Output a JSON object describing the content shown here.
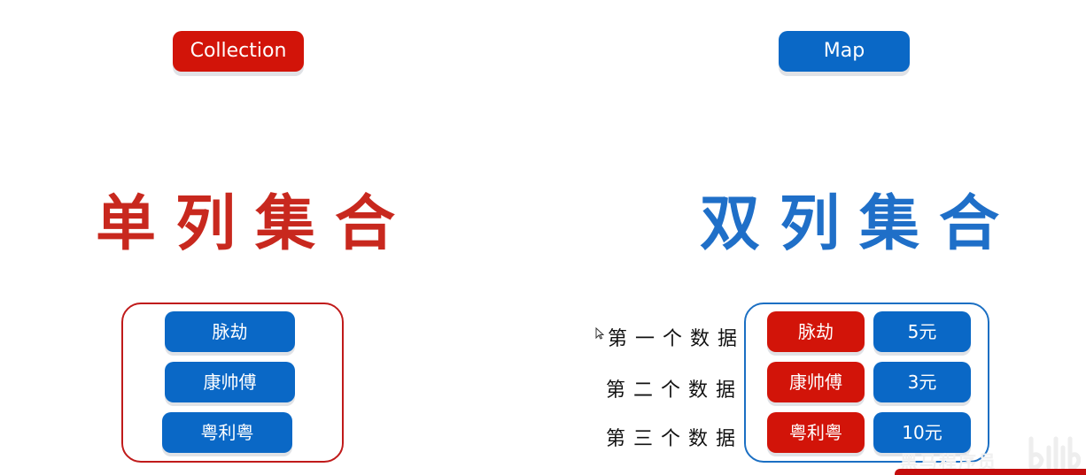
{
  "left": {
    "header_label": "Collection",
    "big_title": "单列集合",
    "items": [
      "脉劫",
      "康帅傅",
      "粤利粤"
    ]
  },
  "right": {
    "header_label": "Map",
    "big_title": "双列集合",
    "rows": [
      {
        "label": "第一个数据",
        "key": "脉劫",
        "value": "5元"
      },
      {
        "label": "第二个数据",
        "key": "康帅傅",
        "value": "3元"
      },
      {
        "label": "第三个数据",
        "key": "粤利粤",
        "value": "10元"
      }
    ]
  },
  "colors": {
    "red": "#d21409",
    "blue": "#0a68c6",
    "title_red": "#c8281e",
    "title_blue": "#1f6fc8"
  },
  "watermark": {
    "text": "黑马程序员"
  }
}
